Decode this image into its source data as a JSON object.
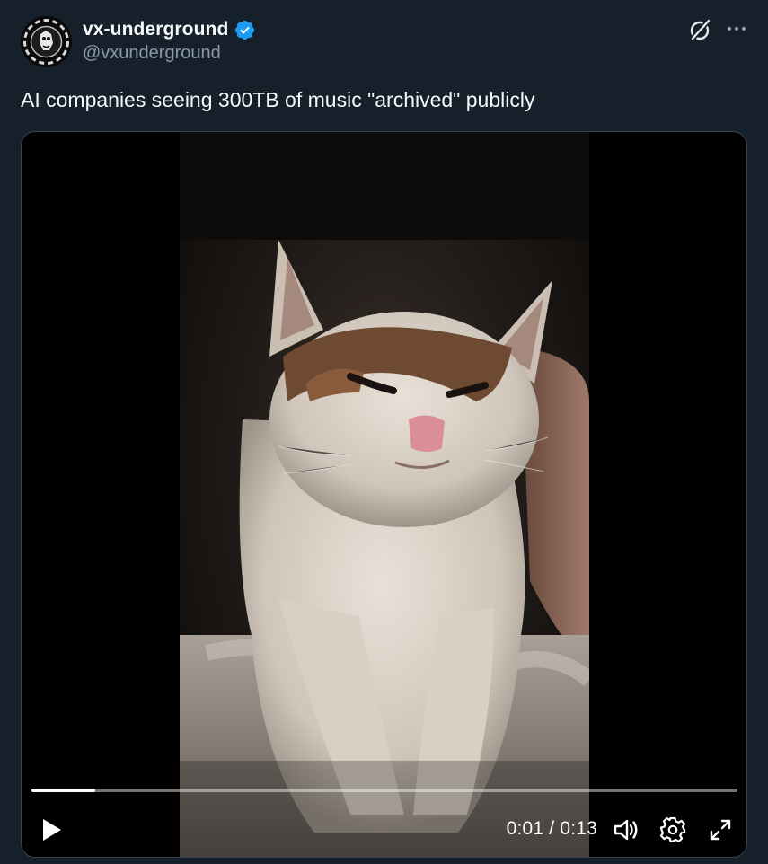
{
  "author": {
    "name": "vx-underground",
    "handle": "@vxunderground",
    "verified": true,
    "verified_color": "#1d9bf0"
  },
  "tweet": {
    "text": "AI companies seeing 300TB of music \"archived\" publicly"
  },
  "header_icons": [
    "grok-icon",
    "more-icon"
  ],
  "video": {
    "current_time": "0:01",
    "separator": "/",
    "duration": "0:13",
    "progress_fraction": 0.09,
    "controls": [
      "play-icon",
      "volume-icon",
      "settings-icon",
      "fullscreen-icon"
    ]
  },
  "colors": {
    "background": "#15202b",
    "text_primary": "#f7f9f9",
    "text_secondary": "#8b98a5",
    "media_border": "#38444d"
  }
}
